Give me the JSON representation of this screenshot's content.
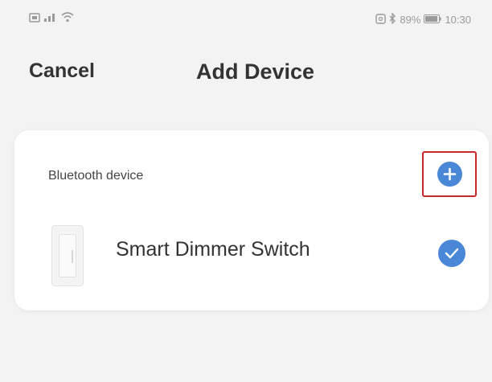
{
  "status_bar": {
    "battery_percent": "89%",
    "time": "10:30",
    "icons": [
      "sim-icon",
      "signal-icon",
      "wifi-icon",
      "nfc-icon",
      "bluetooth-icon",
      "battery-icon"
    ]
  },
  "header": {
    "cancel_label": "Cancel",
    "title": "Add Device"
  },
  "card": {
    "section_label": "Bluetooth device",
    "add_icon": "plus-circle-icon",
    "device": {
      "name": "Smart Dimmer Switch",
      "selected": true,
      "selected_icon": "check-circle-icon"
    }
  },
  "colors": {
    "background": "#f3f3f3",
    "card": "#ffffff",
    "accent_blue": "#4a87d6",
    "highlight_red": "#c9282f",
    "text": "#333333",
    "status_text": "#9a9a9a"
  }
}
